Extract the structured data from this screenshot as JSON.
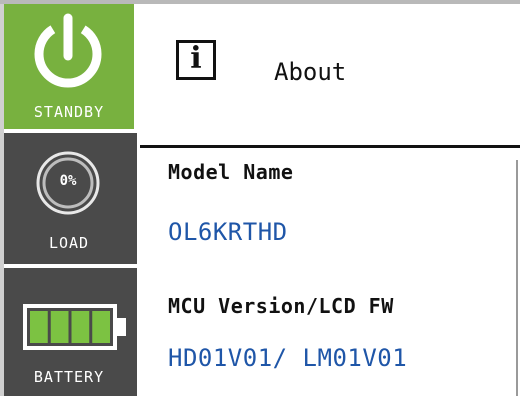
{
  "sidebar": {
    "standby": {
      "label": "STANDBY"
    },
    "load": {
      "label": "LOAD",
      "percent_text": "0%",
      "value_percent": 0
    },
    "battery": {
      "label": "BATTERY",
      "level_bars": 4,
      "level_max": 4
    }
  },
  "main": {
    "title": "About",
    "info_icon": "info-icon",
    "fields": [
      {
        "label": "Model Name",
        "value": "OL6KRTHD"
      },
      {
        "label": "MCU Version/LCD FW",
        "value": "HD01V01/ LM01V01"
      }
    ]
  },
  "colors": {
    "standby_bg": "#78b13f",
    "tile_bg": "#4a4a4a",
    "value_text": "#1f56a8",
    "battery_fill": "#7cc242"
  }
}
